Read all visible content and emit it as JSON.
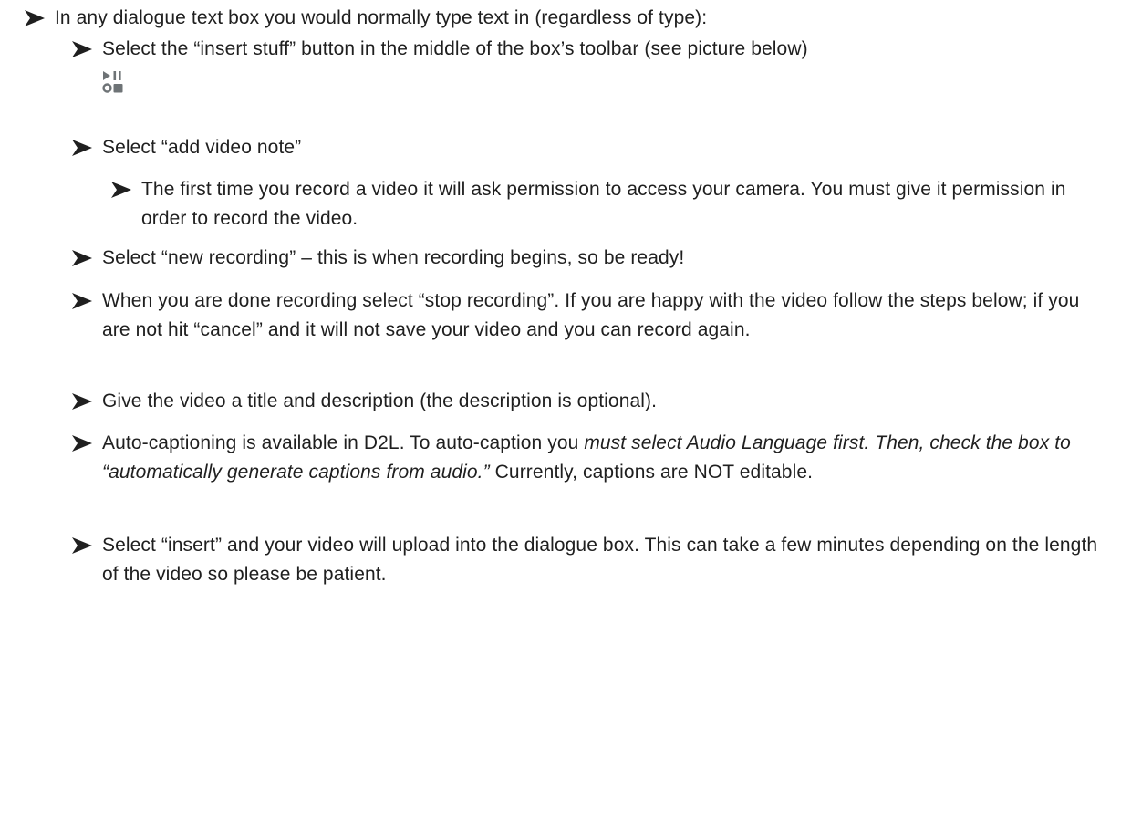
{
  "instructions": {
    "intro": "In any dialogue text box you would normally type text in (regardless of type):",
    "step_insert_stuff": "Select the “insert stuff” button in the middle of the box’s toolbar (see picture below)",
    "insert_stuff_icon": "insert-stuff-icon",
    "step_add_video_note": "Select “add video note”",
    "note_permission": "The first time you record a video it will ask permission to access your camera. You must give it permission in order to record the video.",
    "step_new_recording": "Select “new recording” – this is when recording begins, so be ready!",
    "step_stop_recording": "When you are done recording select “stop recording”. If you are happy with the video follow the steps below; if you are not hit “cancel” and it will not save your video and you can record again.",
    "step_title": "Give the video a title and description (the description is optional).",
    "captions_start": "Auto-captioning is available in D2L. To auto-caption you ",
    "captions_emphasis": "must select Audio Language first. Then, check the box to “automatically generate captions from audio.”",
    "captions_end": " Currently, captions are NOT editable.",
    "step_insert": "Select “insert” and your video will upload into the dialogue box. This can take a few minutes depending on the length of the video so please be patient."
  },
  "colors": {
    "text": "#1f1f1f",
    "icon": "#6e7376"
  }
}
